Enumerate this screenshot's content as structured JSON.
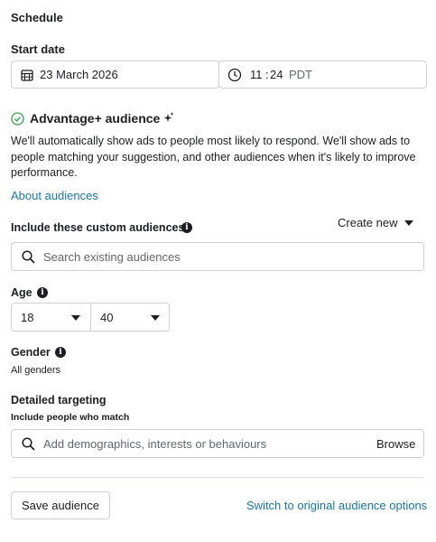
{
  "schedule": {
    "title": "Schedule",
    "start_date_label": "Start date",
    "date_value": "23 March 2026",
    "time_hour": "11",
    "time_sep": ":",
    "time_minute": "24",
    "timezone": "PDT"
  },
  "advantage": {
    "title": "Advantage+ audience",
    "description": "We'll automatically show ads to people most likely to respond. We'll show ads to people matching your suggestion, and other audiences when it's likely to improve performance.",
    "about_link": "About audiences"
  },
  "custom_audiences": {
    "label": "Include these custom audiences",
    "create_new": "Create new",
    "search_placeholder": "Search existing audiences"
  },
  "age": {
    "label": "Age",
    "min": "18",
    "max": "40"
  },
  "gender": {
    "label": "Gender",
    "value": "All genders"
  },
  "detailed_targeting": {
    "label": "Detailed targeting",
    "sublabel": "Include people who match",
    "placeholder": "Add demographics, interests or behaviours",
    "browse": "Browse"
  },
  "footer": {
    "save_button": "Save audience",
    "switch_link": "Switch to original audience options"
  },
  "colors": {
    "link": "#1877a8",
    "border": "#ced0d4",
    "check": "#31a24c"
  }
}
